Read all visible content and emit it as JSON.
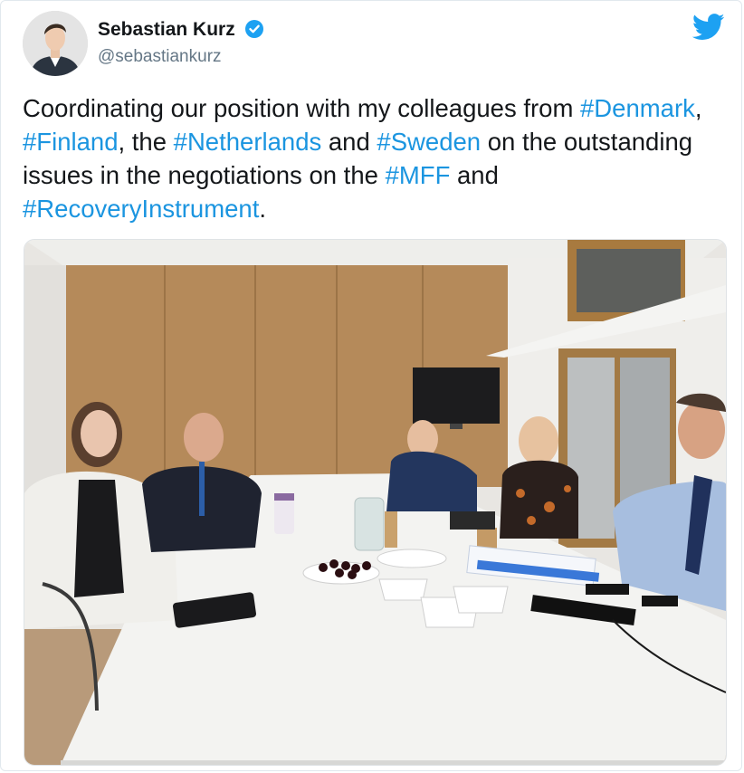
{
  "author": {
    "name": "Sebastian Kurz",
    "handle": "@sebastiankurz",
    "verified": true,
    "avatar_icon": "profile-photo"
  },
  "logo_icon": "twitter-bird-icon",
  "tweet": {
    "segments": [
      {
        "text": "Coordinating our position with my colleagues from ",
        "hashtag": false
      },
      {
        "text": "#Denmark",
        "hashtag": true
      },
      {
        "text": ", ",
        "hashtag": false
      },
      {
        "text": "#Finland",
        "hashtag": true
      },
      {
        "text": ", the ",
        "hashtag": false
      },
      {
        "text": "#Netherlands",
        "hashtag": true
      },
      {
        "text": " and ",
        "hashtag": false
      },
      {
        "text": "#Sweden",
        "hashtag": true
      },
      {
        "text": " on the outstanding issues in the negotiations on the ",
        "hashtag": false
      },
      {
        "text": "#MFF",
        "hashtag": true
      },
      {
        "text": " and ",
        "hashtag": false
      },
      {
        "text": "#RecoveryInstrument",
        "hashtag": true
      },
      {
        "text": ".",
        "hashtag": false
      }
    ]
  },
  "colors": {
    "link": "#1b95e0",
    "twitter_blue": "#1da1f2",
    "text": "#14171a",
    "muted": "#657786"
  }
}
